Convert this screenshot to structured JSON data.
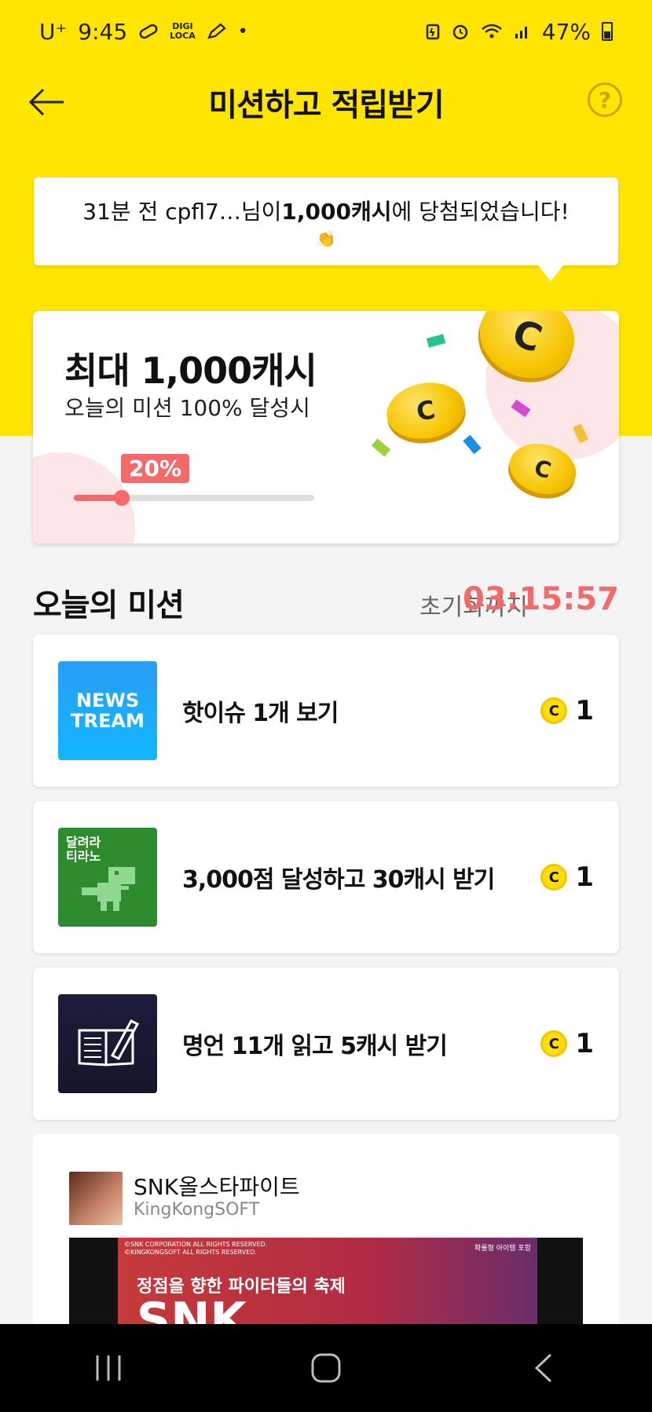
{
  "status_bar": {
    "carrier": "U⁺",
    "time": "9:45",
    "digi_label": "DIGI\nLOCA",
    "battery": "47%",
    "icons": [
      "pill-icon",
      "digi-loca-icon",
      "pencil-icon",
      "dot-icon",
      "battery-saver-icon",
      "alarm-icon",
      "wifi-icon",
      "signal-icon",
      "battery-icon"
    ]
  },
  "app_bar": {
    "title": "미션하고 적립받기",
    "help": "?"
  },
  "notice": {
    "prefix": "31분 전 cpfl7…님이 ",
    "amount": "1,000캐시",
    "suffix": "에 당첨되었습니다!",
    "emoji": "👏"
  },
  "reward_card": {
    "title": "최대 1,000캐시",
    "subtitle": "오늘의 미션 100% 달성시",
    "progress_label": "20%",
    "progress": 0.2,
    "coin_symbol": "C",
    "confetti_colors": [
      "#27c48a",
      "#d44ad0",
      "#1b8fe6",
      "#9bd33a",
      "#f5c13a"
    ]
  },
  "missions": {
    "title": "오늘의 미션",
    "reset_label": "초기화까지",
    "reset_time": "03:15:57",
    "items": [
      {
        "thumb": "NEWS\nTREAM",
        "label": "핫이슈 1개 보기",
        "reward": "1",
        "coin": "C"
      },
      {
        "thumb": "달려라\n티라노",
        "label": "3,000점 달성하고 30캐시 받기",
        "reward": "1",
        "coin": "C"
      },
      {
        "thumb": "",
        "label": "명언 11개 읽고 5캐시 받기",
        "reward": "1",
        "coin": "C"
      }
    ]
  },
  "ad": {
    "app_name": "SNK올스타파이트",
    "developer": "KingKongSOFT",
    "copyright": "©SNK CORPORATION ALL RIGHTS RESERVED.\n©KINGKONGSOFT ALL RIGHTS RESERVED.",
    "notice": "확률형 아이템 포함",
    "tagline": "정점을 향한 파이터들의 축제",
    "headline": "SNK"
  }
}
